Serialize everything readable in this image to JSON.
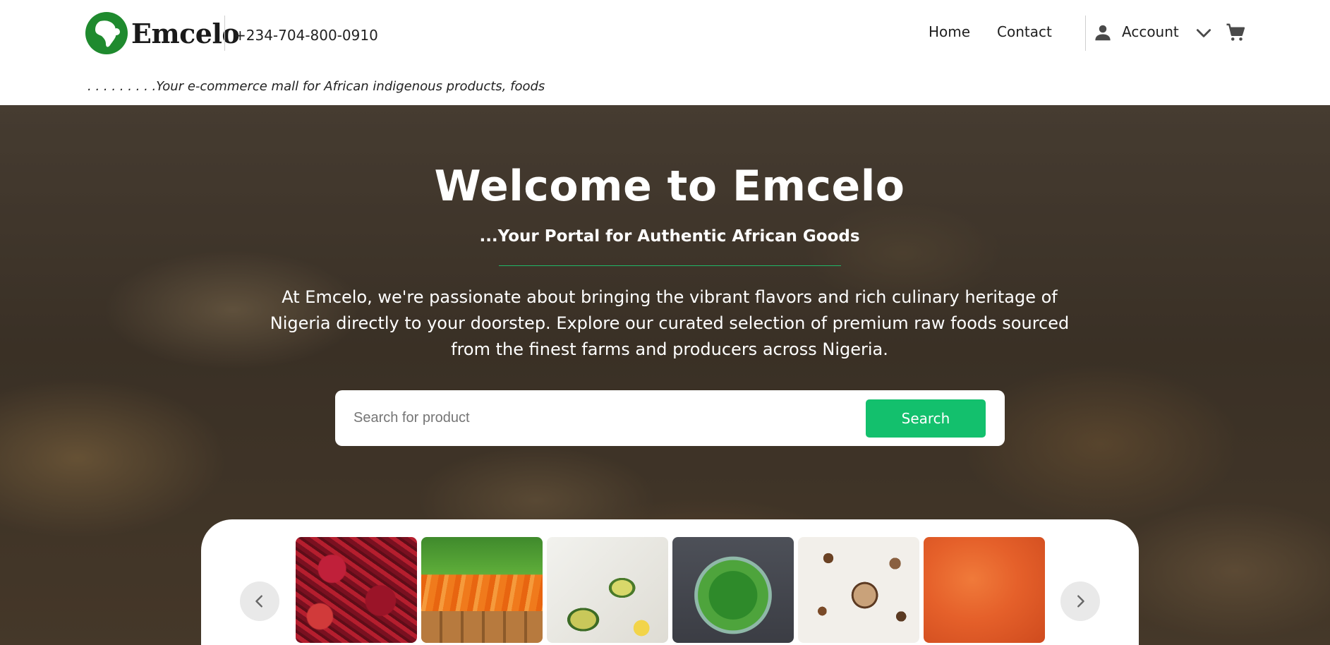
{
  "header": {
    "brand": "Emcelo",
    "phone": "+234-704-800-0910",
    "nav": {
      "home": "Home",
      "contact": "Contact"
    },
    "account_label": "Account",
    "tagline": ". . . . . . . . .Your e-commerce mall for African indigenous products, foods"
  },
  "hero": {
    "title": "Welcome to Emcelo",
    "subtitle": "...Your Portal for Authentic African Goods",
    "description": "At Emcelo, we're passionate about bringing the vibrant flavors and rich culinary heritage of Nigeria directly to your doorstep. Explore our curated selection of premium raw foods sourced from the finest farms and producers across Nigeria."
  },
  "search": {
    "placeholder": "Search for product",
    "value": "",
    "button_label": "Search"
  },
  "carousel": {
    "items": [
      {
        "image": "dried-red-peppers"
      },
      {
        "image": "carrots-in-crate"
      },
      {
        "image": "sliced-avocados"
      },
      {
        "image": "spinach-bowl"
      },
      {
        "image": "mushrooms-and-spices"
      },
      {
        "image": "ground-pepper-powder"
      }
    ]
  },
  "colors": {
    "accent": "#13c06d",
    "logo_green": "#1f8a2e",
    "text": "#1e1e1e"
  },
  "icons": {
    "account": "person-icon",
    "dropdown": "chevron-down-icon",
    "cart": "cart-icon",
    "prev": "chevron-left-icon",
    "next": "chevron-right-icon"
  }
}
